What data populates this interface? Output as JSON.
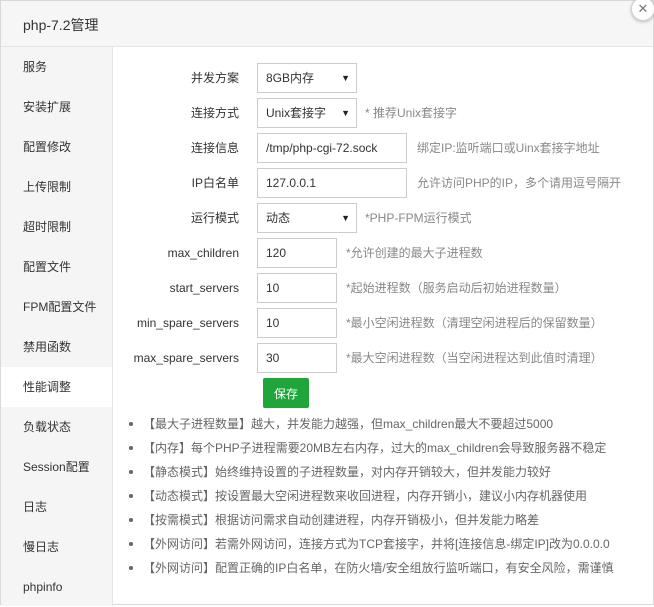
{
  "window": {
    "title": "php-7.2管理",
    "close_glyph": "✕"
  },
  "sidebar": {
    "items": [
      {
        "label": "服务"
      },
      {
        "label": "安装扩展"
      },
      {
        "label": "配置修改"
      },
      {
        "label": "上传限制"
      },
      {
        "label": "超时限制"
      },
      {
        "label": "配置文件"
      },
      {
        "label": "FPM配置文件"
      },
      {
        "label": "禁用函数"
      },
      {
        "label": "性能调整"
      },
      {
        "label": "负载状态"
      },
      {
        "label": "Session配置"
      },
      {
        "label": "日志"
      },
      {
        "label": "慢日志"
      },
      {
        "label": "phpinfo"
      }
    ],
    "active_index": 8
  },
  "form": {
    "concurrency": {
      "label": "并发方案",
      "value": "8GB内存"
    },
    "connect_mode": {
      "label": "连接方式",
      "value": "Unix套接字",
      "hint": "* 推荐Unix套接字"
    },
    "connect_info": {
      "label": "连接信息",
      "value": "/tmp/php-cgi-72.sock",
      "hint": "绑定IP:监听端口或Uinx套接字地址"
    },
    "ip_whitelist": {
      "label": "IP白名单",
      "value": "127.0.0.1",
      "hint": "允许访问PHP的IP，多个请用逗号隔开"
    },
    "run_mode": {
      "label": "运行模式",
      "value": "动态",
      "hint": "*PHP-FPM运行模式"
    },
    "max_children": {
      "label": "max_children",
      "value": "120",
      "hint": "*允许创建的最大子进程数"
    },
    "start_servers": {
      "label": "start_servers",
      "value": "10",
      "hint": "*起始进程数（服务启动后初始进程数量）"
    },
    "min_spare_servers": {
      "label": "min_spare_servers",
      "value": "10",
      "hint": "*最小空闲进程数（清理空闲进程后的保留数量）"
    },
    "max_spare_servers": {
      "label": "max_spare_servers",
      "value": "30",
      "hint": "*最大空闲进程数（当空闲进程达到此值时清理）"
    },
    "save_label": "保存"
  },
  "tips": [
    "【最大子进程数量】越大，并发能力越强，但max_children最大不要超过5000",
    "【内存】每个PHP子进程需要20MB左右内存，过大的max_children会导致服务器不稳定",
    "【静态模式】始终维持设置的子进程数量，对内存开销较大，但并发能力较好",
    "【动态模式】按设置最大空闲进程数来收回进程，内存开销小，建议小内存机器使用",
    "【按需模式】根据访问需求自动创建进程，内存开销极小，但并发能力略差",
    "【外网访问】若需外网访问，连接方式为TCP套接字，并将[连接信息-绑定IP]改为0.0.0.0",
    "【外网访问】配置正确的IP白名单，在防火墙/安全组放行监听端口，有安全风险，需谨慎"
  ],
  "colors": {
    "accent_green": "#20a53a",
    "sidebar_bg": "#f5f5f5",
    "title_bg": "#f6f6f6"
  }
}
